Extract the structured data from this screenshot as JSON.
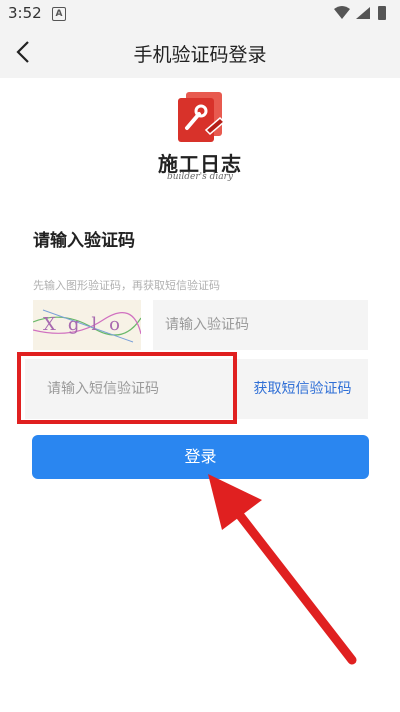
{
  "status_bar": {
    "time": "3:52",
    "notification_letter": "A"
  },
  "nav": {
    "title": "手机验证码登录"
  },
  "logo": {
    "title": "施工日志",
    "subtitle": "builder's diary"
  },
  "form": {
    "section_title": "请输入验证码",
    "hint": "先输入图形验证码，再获取短信验证码",
    "captcha_text": "Xglo",
    "captcha_placeholder": "请输入验证码",
    "sms_placeholder": "请输入短信验证码",
    "get_code_label": "获取短信验证码",
    "login_label": "登录"
  },
  "colors": {
    "accent": "#2a86f0",
    "link": "#2f6fd6",
    "highlight": "#e02020",
    "logo_red": "#d8322a"
  }
}
